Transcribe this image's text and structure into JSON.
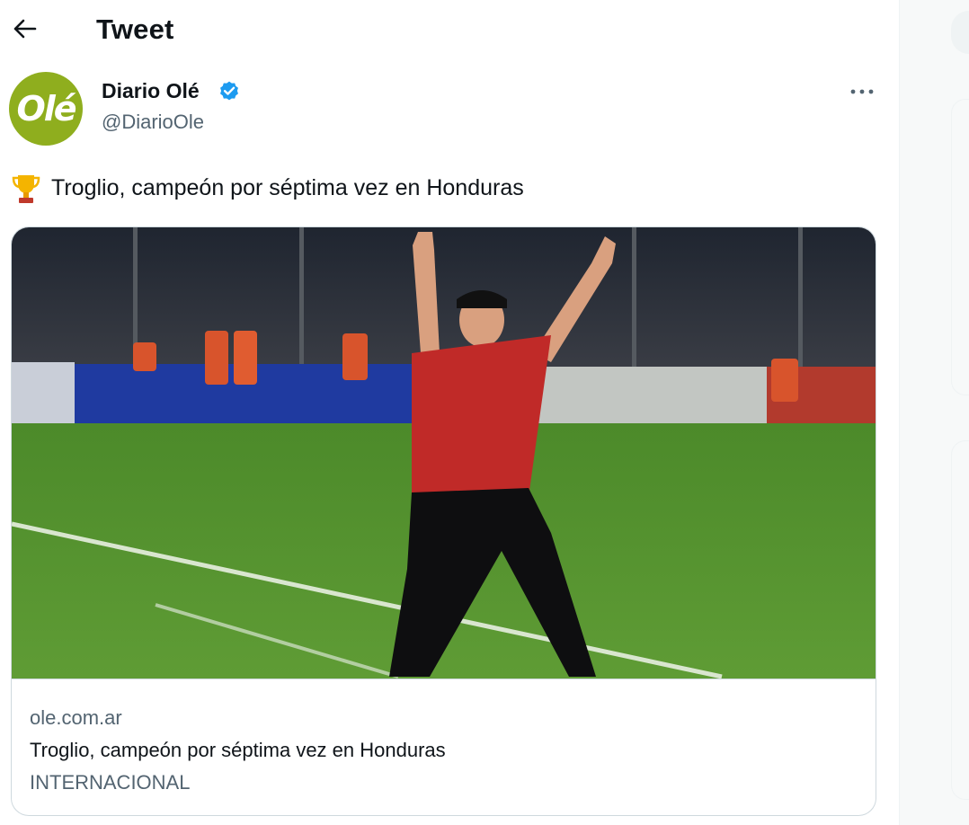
{
  "header": {
    "title": "Tweet",
    "back_icon": "arrow-left-icon"
  },
  "author": {
    "avatar_text": "Olé",
    "avatar_color": "#8fae1e",
    "name": "Diario Olé",
    "handle": "@DiarioOle",
    "verified": true,
    "verified_color": "#1d9bf0"
  },
  "tweet": {
    "emoji_icon": "trophy-icon",
    "text": "Troglio, campeón por séptima vez en Honduras"
  },
  "link_card": {
    "image_icon": "photo-coach-celebrating",
    "domain": "ole.com.ar",
    "title": "Troglio, campeón por séptima vez en Honduras",
    "description": "INTERNACIONAL"
  },
  "colors": {
    "text_primary": "#0f1419",
    "text_secondary": "#536471",
    "border": "#cfd9de",
    "accent": "#1d9bf0"
  }
}
